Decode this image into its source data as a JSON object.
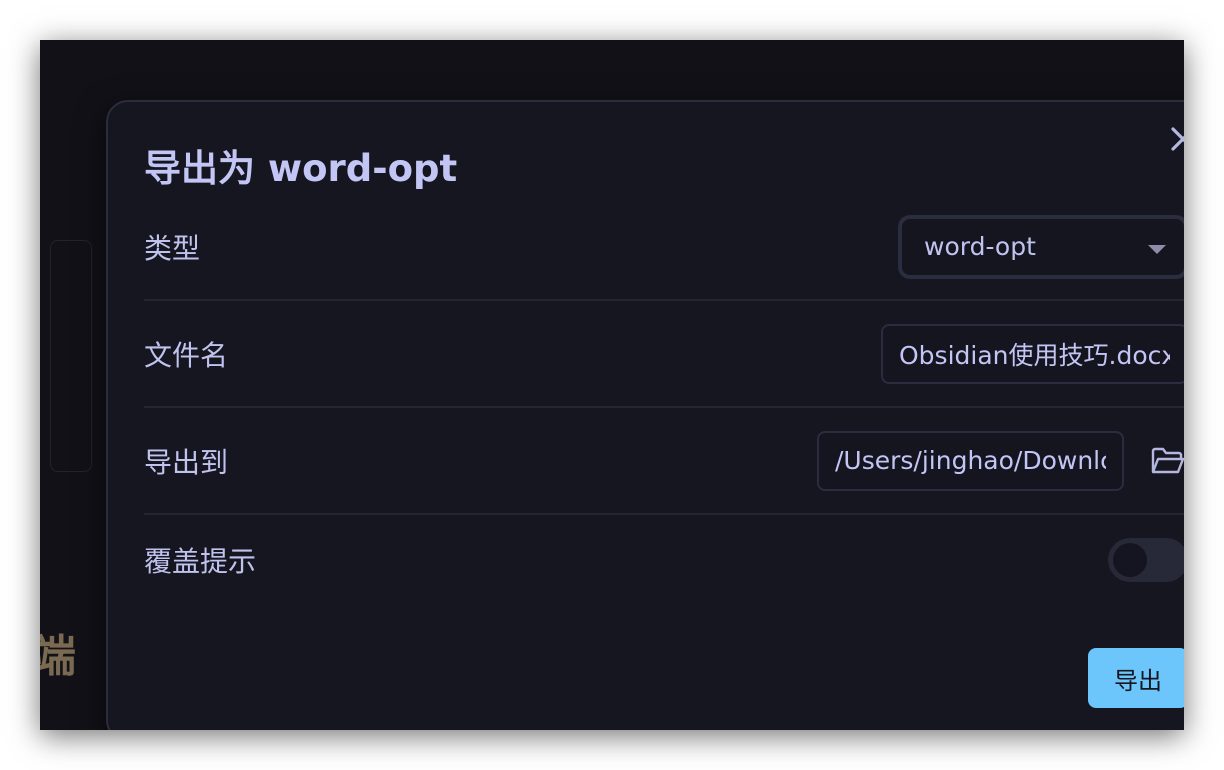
{
  "background": {
    "partial_text": "端"
  },
  "dialog": {
    "title": "导出为 word-opt",
    "close_icon": "close-icon",
    "accent_color": "#6cc6fc",
    "fields": {
      "type": {
        "label": "类型",
        "selected_value": "word-opt",
        "icon": "chevron-down-icon"
      },
      "filename": {
        "label": "文件名",
        "value": "Obsidian使用技巧.docx"
      },
      "export_to": {
        "label": "导出到",
        "value": "/Users/jinghao/Downlc",
        "icon": "folder-open-icon"
      },
      "overwrite_prompt": {
        "label": "覆盖提示",
        "enabled": false
      }
    },
    "export_button": {
      "label": "导出"
    }
  }
}
